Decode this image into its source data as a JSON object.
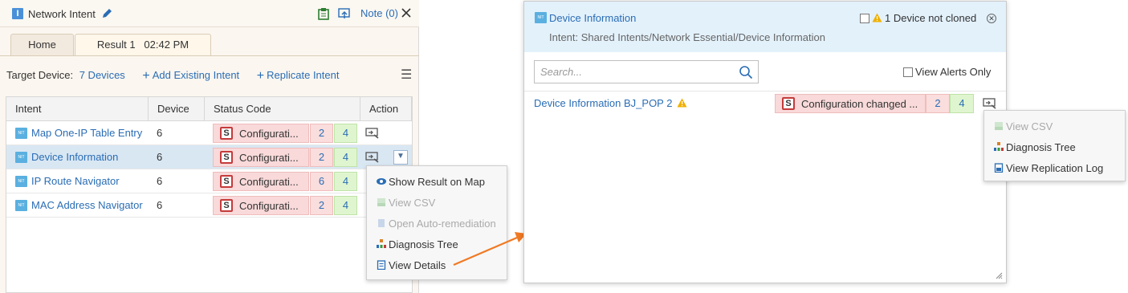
{
  "left_panel": {
    "title": "Network Intent",
    "note": "Note (0)",
    "tabs": [
      {
        "label": "Home"
      },
      {
        "label": "Result 1   02:42 PM"
      }
    ],
    "target_label": "Target Device:",
    "target_value": "7 Devices",
    "add_existing": "Add Existing Intent",
    "replicate": "Replicate Intent"
  },
  "table": {
    "columns": [
      "Intent",
      "Device",
      "Status Code",
      "Action"
    ],
    "rows": [
      {
        "intent": "Map One-IP Table Entry",
        "device": "6",
        "status": "Configurati...",
        "red": "2",
        "green": "4"
      },
      {
        "intent": "Device Information",
        "device": "6",
        "status": "Configurati...",
        "red": "2",
        "green": "4"
      },
      {
        "intent": "IP Route Navigator",
        "device": "6",
        "status": "Configurati...",
        "red": "6",
        "green": "4"
      },
      {
        "intent": "MAC Address Navigator",
        "device": "6",
        "status": "Configurati...",
        "red": "2",
        "green": "4"
      }
    ],
    "status_badge": "S"
  },
  "context_menu": {
    "items": [
      {
        "label": "Show Result on Map",
        "enabled": true
      },
      {
        "label": "View CSV",
        "enabled": false
      },
      {
        "label": "Open Auto-remediation",
        "enabled": false
      },
      {
        "label": "Diagnosis Tree",
        "enabled": true
      },
      {
        "label": "View Details",
        "enabled": true
      }
    ]
  },
  "dialog": {
    "title": "Device Information",
    "subtitle": "Intent: Shared Intents/Network Essential/Device Information",
    "clone_status": "1 Device not cloned",
    "search_placeholder": "Search...",
    "view_alerts": "View Alerts Only",
    "row_label": "Device Information BJ_POP 2",
    "row_status": "Configuration changed ...",
    "row_red": "2",
    "row_green": "4"
  },
  "right_menu": {
    "items": [
      {
        "label": "View CSV",
        "enabled": false
      },
      {
        "label": "Diagnosis Tree",
        "enabled": true
      },
      {
        "label": "View Replication Log",
        "enabled": true
      }
    ]
  },
  "colors": {
    "link": "#2a6db5",
    "status_red": "#f9d9d9",
    "count_green": "#dff5cf",
    "header_blue": "#e3f1fb",
    "arrow": "#f07a24"
  }
}
